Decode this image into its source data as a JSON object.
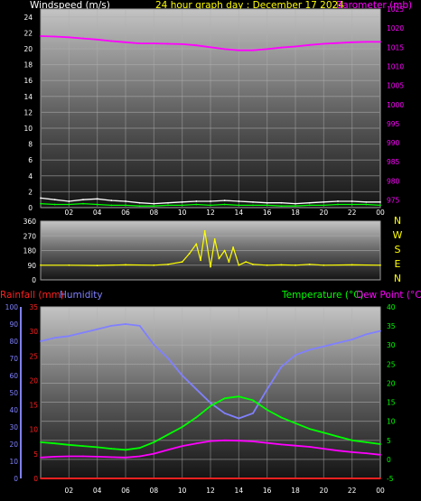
{
  "header": {
    "wind_title": "Windspeed (m/s)",
    "main_title": "24 hour graph day : December 17 2024",
    "baro_title": "Barometer (mb)"
  },
  "legend": {
    "rainfall": "Rainfall (mm)",
    "humidity": "Humidity",
    "temperature": "Temperature (°C)",
    "dewpoint": "Dew Point (°C)"
  },
  "colors": {
    "wind": "#ffffff",
    "gust": "#00ff00",
    "barometer": "#ff00ff",
    "direction": "#ffff00",
    "rain": "#ff2020",
    "humidity": "#8080ff",
    "temperature": "#00ff00",
    "dewpoint": "#ff00ff",
    "rain_rate": "#ffff00",
    "axis_text": "#ffffff",
    "baro_axis": "#ff00ff",
    "temp_axis": "#00ff00",
    "rain_axis": "#ff2020",
    "hum_axis": "#8080ff"
  },
  "time_ticks": [
    "02",
    "04",
    "06",
    "08",
    "10",
    "12",
    "14",
    "16",
    "18",
    "20",
    "22",
    "00"
  ],
  "compass_letters": [
    "N",
    "W",
    "S",
    "E",
    "N"
  ],
  "chart_data": [
    {
      "type": "line",
      "title": "Windspeed (m/s) / Barometer (mb)",
      "xlabel": "",
      "x_ticks": [
        "02",
        "04",
        "06",
        "08",
        "10",
        "12",
        "14",
        "16",
        "18",
        "20",
        "22",
        "00"
      ],
      "y_left": {
        "label": "Windspeed (m/s)",
        "ticks": [
          "24",
          "22",
          "20",
          "18",
          "16",
          "14",
          "12",
          "10",
          "8",
          "6",
          "4",
          "2",
          "0"
        ],
        "lim": [
          0,
          25
        ]
      },
      "y_right": {
        "label": "Barometer (mb)",
        "ticks": [
          "1025",
          "1020",
          "1015",
          "1010",
          "1005",
          "1000",
          "995",
          "990",
          "985",
          "980",
          "975"
        ],
        "lim": [
          973,
          1025
        ]
      },
      "series": [
        {
          "name": "Barometer (mb)",
          "axis": "right",
          "x": [
            0,
            1,
            2,
            3,
            4,
            5,
            6,
            7,
            8,
            9,
            10,
            11,
            12,
            13,
            14,
            15,
            16,
            17,
            18,
            19,
            20,
            21,
            22,
            23,
            24
          ],
          "values": [
            1017.9,
            1017.8,
            1017.6,
            1017.3,
            1017.0,
            1016.6,
            1016.3,
            1016.0,
            1016.0,
            1015.9,
            1015.8,
            1015.5,
            1015.0,
            1014.5,
            1014.2,
            1014.2,
            1014.5,
            1014.9,
            1015.2,
            1015.6,
            1015.9,
            1016.1,
            1016.3,
            1016.4,
            1016.4
          ]
        },
        {
          "name": "Windspeed",
          "axis": "left",
          "x": [
            0,
            1,
            2,
            3,
            4,
            5,
            6,
            7,
            8,
            9,
            10,
            11,
            12,
            13,
            14,
            15,
            16,
            17,
            18,
            19,
            20,
            21,
            22,
            23,
            24
          ],
          "values": [
            1.2,
            1.0,
            0.8,
            1.0,
            1.1,
            0.9,
            0.8,
            0.6,
            0.5,
            0.6,
            0.7,
            0.8,
            0.8,
            0.9,
            0.8,
            0.7,
            0.6,
            0.6,
            0.5,
            0.6,
            0.7,
            0.8,
            0.8,
            0.7,
            0.7
          ]
        },
        {
          "name": "Gust",
          "axis": "left",
          "x": [
            0,
            1,
            2,
            3,
            4,
            5,
            6,
            7,
            8,
            9,
            10,
            11,
            12,
            13,
            14,
            15,
            16,
            17,
            18,
            19,
            20,
            21,
            22,
            23,
            24
          ],
          "values": [
            0.5,
            0.4,
            0.4,
            0.5,
            0.4,
            0.3,
            0.3,
            0.2,
            0.2,
            0.3,
            0.3,
            0.4,
            0.3,
            0.4,
            0.3,
            0.3,
            0.3,
            0.2,
            0.2,
            0.3,
            0.3,
            0.4,
            0.4,
            0.4,
            0.3
          ]
        }
      ]
    },
    {
      "type": "line",
      "title": "Wind direction",
      "x_ticks": [],
      "y_left": {
        "ticks": [
          "360",
          "270",
          "180",
          "90",
          "0"
        ],
        "lim": [
          0,
          360
        ]
      },
      "series": [
        {
          "name": "Wind direction",
          "x": [
            0,
            2,
            4,
            6,
            8,
            9,
            10,
            10.5,
            11,
            11.3,
            11.6,
            12,
            12.3,
            12.6,
            13,
            13.3,
            13.6,
            14,
            14.5,
            15,
            16,
            17,
            18,
            19,
            20,
            22,
            24
          ],
          "values": [
            90,
            90,
            88,
            92,
            90,
            95,
            110,
            160,
            220,
            120,
            300,
            80,
            250,
            130,
            180,
            110,
            200,
            90,
            110,
            95,
            90,
            92,
            90,
            95,
            90,
            92,
            90
          ]
        }
      ]
    },
    {
      "type": "line",
      "title": "Rainfall / Humidity / Temperature / Dew Point",
      "x_ticks": [
        "02",
        "04",
        "06",
        "08",
        "10",
        "12",
        "14",
        "16",
        "18",
        "20",
        "22",
        "00"
      ],
      "y_far_left": {
        "label": "Humidity",
        "ticks": [
          "100",
          "90",
          "80",
          "70",
          "60",
          "50",
          "40",
          "30",
          "20",
          "10",
          "0"
        ],
        "lim": [
          0,
          100
        ]
      },
      "y_left": {
        "label": "Rainfall (mm)",
        "ticks": [
          "35",
          "30",
          "25",
          "20",
          "15",
          "10",
          "5",
          "0"
        ],
        "lim": [
          0,
          35
        ]
      },
      "y_right": {
        "label": "Temperature (°C)",
        "ticks": [
          "40",
          "35",
          "30",
          "25",
          "20",
          "15",
          "10",
          "5",
          "0",
          "-5"
        ],
        "lim": [
          -5,
          40
        ]
      },
      "series": [
        {
          "name": "Humidity",
          "axis": "far_left",
          "x": [
            0,
            1,
            2,
            3,
            4,
            5,
            6,
            7,
            8,
            9,
            10,
            11,
            12,
            13,
            14,
            15,
            16,
            17,
            18,
            19,
            20,
            21,
            22,
            23,
            24
          ],
          "values": [
            80,
            82,
            83,
            85,
            87,
            89,
            90,
            89,
            78,
            70,
            60,
            52,
            44,
            38,
            35,
            38,
            52,
            65,
            72,
            75,
            77,
            79,
            81,
            84,
            86
          ]
        },
        {
          "name": "Temperature (°C)",
          "axis": "right",
          "x": [
            0,
            1,
            2,
            3,
            4,
            5,
            6,
            7,
            8,
            9,
            10,
            11,
            12,
            13,
            14,
            15,
            16,
            17,
            18,
            19,
            20,
            21,
            22,
            23,
            24
          ],
          "values": [
            4.5,
            4.2,
            3.8,
            3.5,
            3.2,
            2.8,
            2.5,
            3.0,
            4.5,
            6.5,
            8.5,
            11.0,
            14.0,
            16.0,
            16.5,
            15.5,
            13.0,
            11.0,
            9.5,
            8.0,
            7.0,
            6.0,
            5.0,
            4.5,
            4.0
          ]
        },
        {
          "name": "Dew Point (°C)",
          "axis": "right",
          "x": [
            0,
            1,
            2,
            3,
            4,
            5,
            6,
            7,
            8,
            9,
            10,
            11,
            12,
            13,
            14,
            15,
            16,
            17,
            18,
            19,
            20,
            21,
            22,
            23,
            24
          ],
          "values": [
            0.5,
            0.7,
            0.8,
            0.8,
            0.7,
            0.6,
            0.5,
            0.8,
            1.5,
            2.5,
            3.5,
            4.2,
            4.8,
            5.0,
            4.9,
            4.7,
            4.3,
            3.9,
            3.6,
            3.3,
            2.8,
            2.3,
            1.9,
            1.6,
            1.2
          ]
        },
        {
          "name": "Rainfall (mm)",
          "axis": "left",
          "x": [
            0,
            24
          ],
          "values": [
            0,
            0
          ]
        }
      ]
    }
  ]
}
